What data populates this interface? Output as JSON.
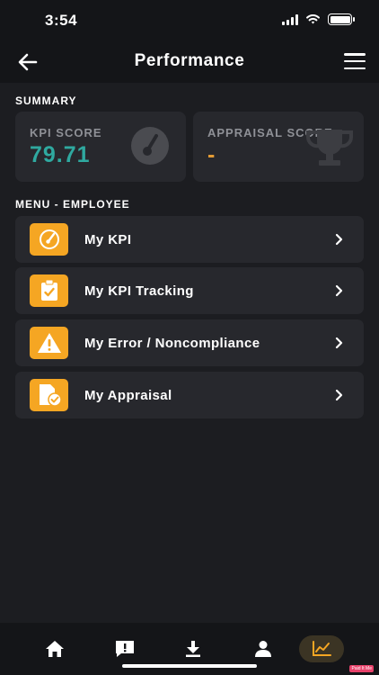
{
  "status_bar": {
    "time": "3:54"
  },
  "header": {
    "title": "Performance"
  },
  "summary": {
    "section_title": "SUMMARY",
    "kpi": {
      "label": "KPI SCORE",
      "value": "79.71"
    },
    "appraisal": {
      "label": "APPRAISAL SCORE",
      "value": "-"
    }
  },
  "menu": {
    "section_title": "MENU - EMPLOYEE",
    "items": [
      {
        "label": "My KPI",
        "icon": "gauge-icon"
      },
      {
        "label": "My KPI Tracking",
        "icon": "clipboard-check-icon"
      },
      {
        "label": "My Error / Noncompliance",
        "icon": "warning-icon"
      },
      {
        "label": "My Appraisal",
        "icon": "document-check-icon"
      }
    ]
  },
  "tab_bar": {
    "tabs": [
      "home-icon",
      "feedback-icon",
      "download-icon",
      "profile-icon",
      "chart-icon"
    ],
    "active": "chart-icon"
  },
  "badge": {
    "text": "Paid It Me"
  },
  "colors": {
    "accent": "#f5a623",
    "kpi_value": "#2fa9a0",
    "appraisal_value": "#e39b35",
    "card": "#27282d",
    "background": "#1c1d21"
  }
}
